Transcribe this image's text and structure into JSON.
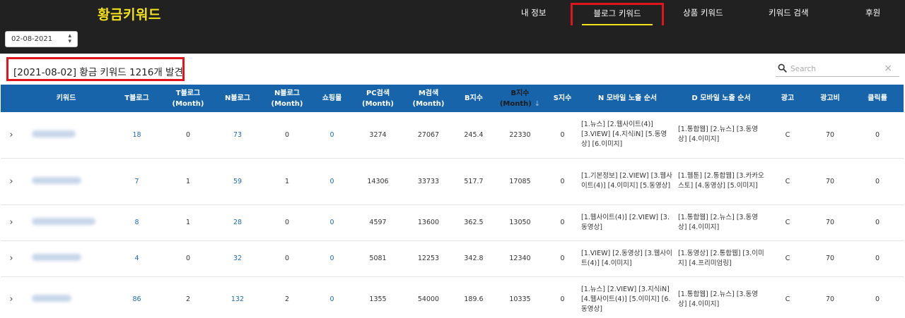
{
  "app": {
    "logo": "황금키워드"
  },
  "nav": {
    "items": [
      {
        "label": "내 정보"
      },
      {
        "label": "블로그 키워드"
      },
      {
        "label": "상품 키워드"
      },
      {
        "label": "키워드 검색"
      },
      {
        "label": "후원"
      }
    ],
    "active": "블로그 키워드"
  },
  "toolbar": {
    "date_value": "02-08-2021",
    "date_arrow": "▲▼"
  },
  "result": {
    "date": "[2021-08-02]",
    "label": " 황금 키워드 ",
    "count": "1216",
    "suffix": "개 발견"
  },
  "search": {
    "placeholder": "Search",
    "clear": "×"
  },
  "table": {
    "headers": [
      {
        "key": "expand",
        "line1": "",
        "line2": ""
      },
      {
        "key": "keyword",
        "line1": "키워드",
        "line2": ""
      },
      {
        "key": "t_blog",
        "line1": "T블로그",
        "line2": ""
      },
      {
        "key": "t_blog_month",
        "line1": "T블로그",
        "line2": "(Month)"
      },
      {
        "key": "n_blog",
        "line1": "N블로그",
        "line2": ""
      },
      {
        "key": "n_blog_month",
        "line1": "N블로그",
        "line2": "(Month)"
      },
      {
        "key": "shop",
        "line1": "쇼핑몰",
        "line2": ""
      },
      {
        "key": "pc",
        "line1": "PC검색",
        "line2": "(Month)"
      },
      {
        "key": "m",
        "line1": "M검색",
        "line2": "(Month)"
      },
      {
        "key": "b_index",
        "line1": "B지수",
        "line2": ""
      },
      {
        "key": "b_index_month",
        "line1": "B지수",
        "line2": "(Month)"
      },
      {
        "key": "s_index",
        "line1": "S지수",
        "line2": ""
      },
      {
        "key": "n_order",
        "line1": "N 모바일 노출 순서",
        "line2": ""
      },
      {
        "key": "d_order",
        "line1": "D 모바일 노출 순서",
        "line2": ""
      },
      {
        "key": "ad",
        "line1": "광고",
        "line2": ""
      },
      {
        "key": "ad_cost",
        "line1": "광고비",
        "line2": ""
      },
      {
        "key": "ctr",
        "line1": "클릭률",
        "line2": ""
      }
    ],
    "sort_arrow": "↓",
    "expand_glyph": "›",
    "rows": [
      {
        "t_blog": "18",
        "t_blog_month": "0",
        "n_blog": "73",
        "n_blog_month": "0",
        "shop": "0",
        "pc": "3274",
        "m": "27067",
        "b_index": "245.4",
        "b_index_month": "22330",
        "s_index": "0",
        "n_order": "[1.뉴스] [2.웹사이트(4)] [3.VIEW] [4.지식iN] [5.동영상] [6.이미지]",
        "d_order": "[1.통합웹] [2.뉴스] [3.동영상] [4.이미지]",
        "ad": "C",
        "ad_cost": "70",
        "ctr": "0"
      },
      {
        "t_blog": "7",
        "t_blog_month": "1",
        "n_blog": "59",
        "n_blog_month": "1",
        "shop": "0",
        "pc": "14306",
        "m": "33733",
        "b_index": "517.7",
        "b_index_month": "17085",
        "s_index": "0",
        "n_order": "[1.기본정보] [2.VIEW] [3.웹사이트(4)] [4.이미지] [5.동영상]",
        "d_order": "[1.웹툰] [2.통합웹] [3.카카오스토] [4.동영상] [5.이미지]",
        "ad": "C",
        "ad_cost": "70",
        "ctr": "0"
      },
      {
        "t_blog": "8",
        "t_blog_month": "1",
        "n_blog": "28",
        "n_blog_month": "0",
        "shop": "0",
        "pc": "4597",
        "m": "13600",
        "b_index": "362.5",
        "b_index_month": "13050",
        "s_index": "0",
        "n_order": "[1.웹사이트(4)] [2.VIEW] [3.동영상]",
        "d_order": "[1.통합웹] [2.뉴스] [3.동영상] [4.이미지]",
        "ad": "C",
        "ad_cost": "70",
        "ctr": "0"
      },
      {
        "t_blog": "4",
        "t_blog_month": "0",
        "n_blog": "32",
        "n_blog_month": "0",
        "shop": "0",
        "pc": "5081",
        "m": "12253",
        "b_index": "342.8",
        "b_index_month": "12340",
        "s_index": "0",
        "n_order": "[1.VIEW] [2.동영상] [3.웹사이트(4)] [4.이미지]",
        "d_order": "[1.동영상] [2.통합웹] [3.이미지] [4.프리미엄링]",
        "ad": "C",
        "ad_cost": "70",
        "ctr": "0"
      },
      {
        "t_blog": "86",
        "t_blog_month": "2",
        "n_blog": "132",
        "n_blog_month": "2",
        "shop": "0",
        "pc": "1355",
        "m": "54000",
        "b_index": "189.6",
        "b_index_month": "10335",
        "s_index": "0",
        "n_order": "[1.뉴스] [2.VIEW] [3.지식iN] [4.웹사이트(4)] [5.이미지] [6.동영상]",
        "d_order": "[1.통합웹] [2.뉴스] [3.동영상] [4.이미지]",
        "ad": "C",
        "ad_cost": "70",
        "ctr": "0"
      }
    ]
  }
}
